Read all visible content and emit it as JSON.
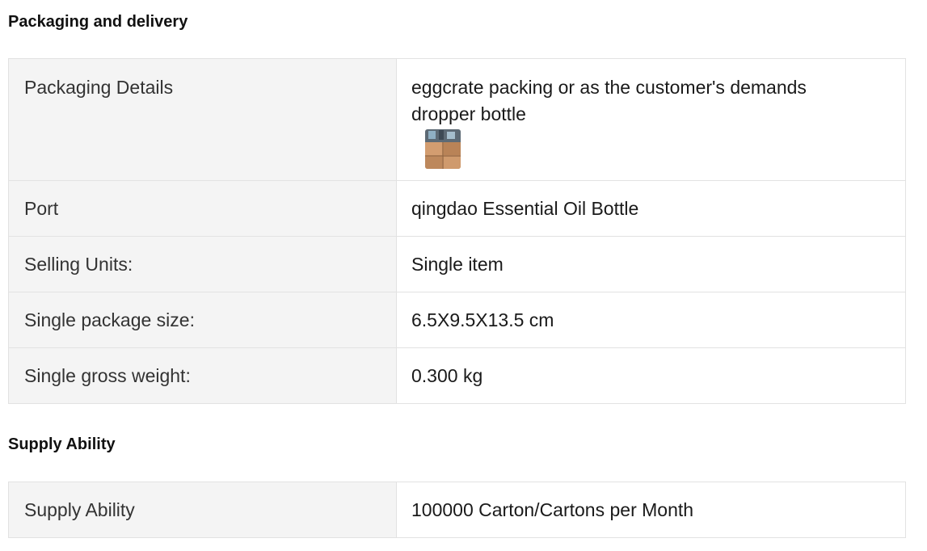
{
  "sections": {
    "packaging": {
      "title": "Packaging and delivery",
      "rows": {
        "packaging_details": {
          "label": "Packaging Details",
          "value_line1": "eggcrate packing or as the customer's demands",
          "value_line2": "dropper bottle"
        },
        "port": {
          "label": "Port",
          "value": "qingdao Essential Oil Bottle"
        },
        "selling_units": {
          "label": "Selling Units:",
          "value": "Single item"
        },
        "package_size": {
          "label": "Single package size:",
          "value": "6.5X9.5X13.5 cm"
        },
        "gross_weight": {
          "label": "Single gross weight:",
          "value": "0.300 kg"
        }
      }
    },
    "supply": {
      "title": "Supply Ability",
      "rows": {
        "supply_ability": {
          "label": "Supply Ability",
          "value": "100000 Carton/Cartons per Month"
        }
      }
    }
  },
  "thumbnail": {
    "icon": "packaging-photo-thumbnail"
  }
}
